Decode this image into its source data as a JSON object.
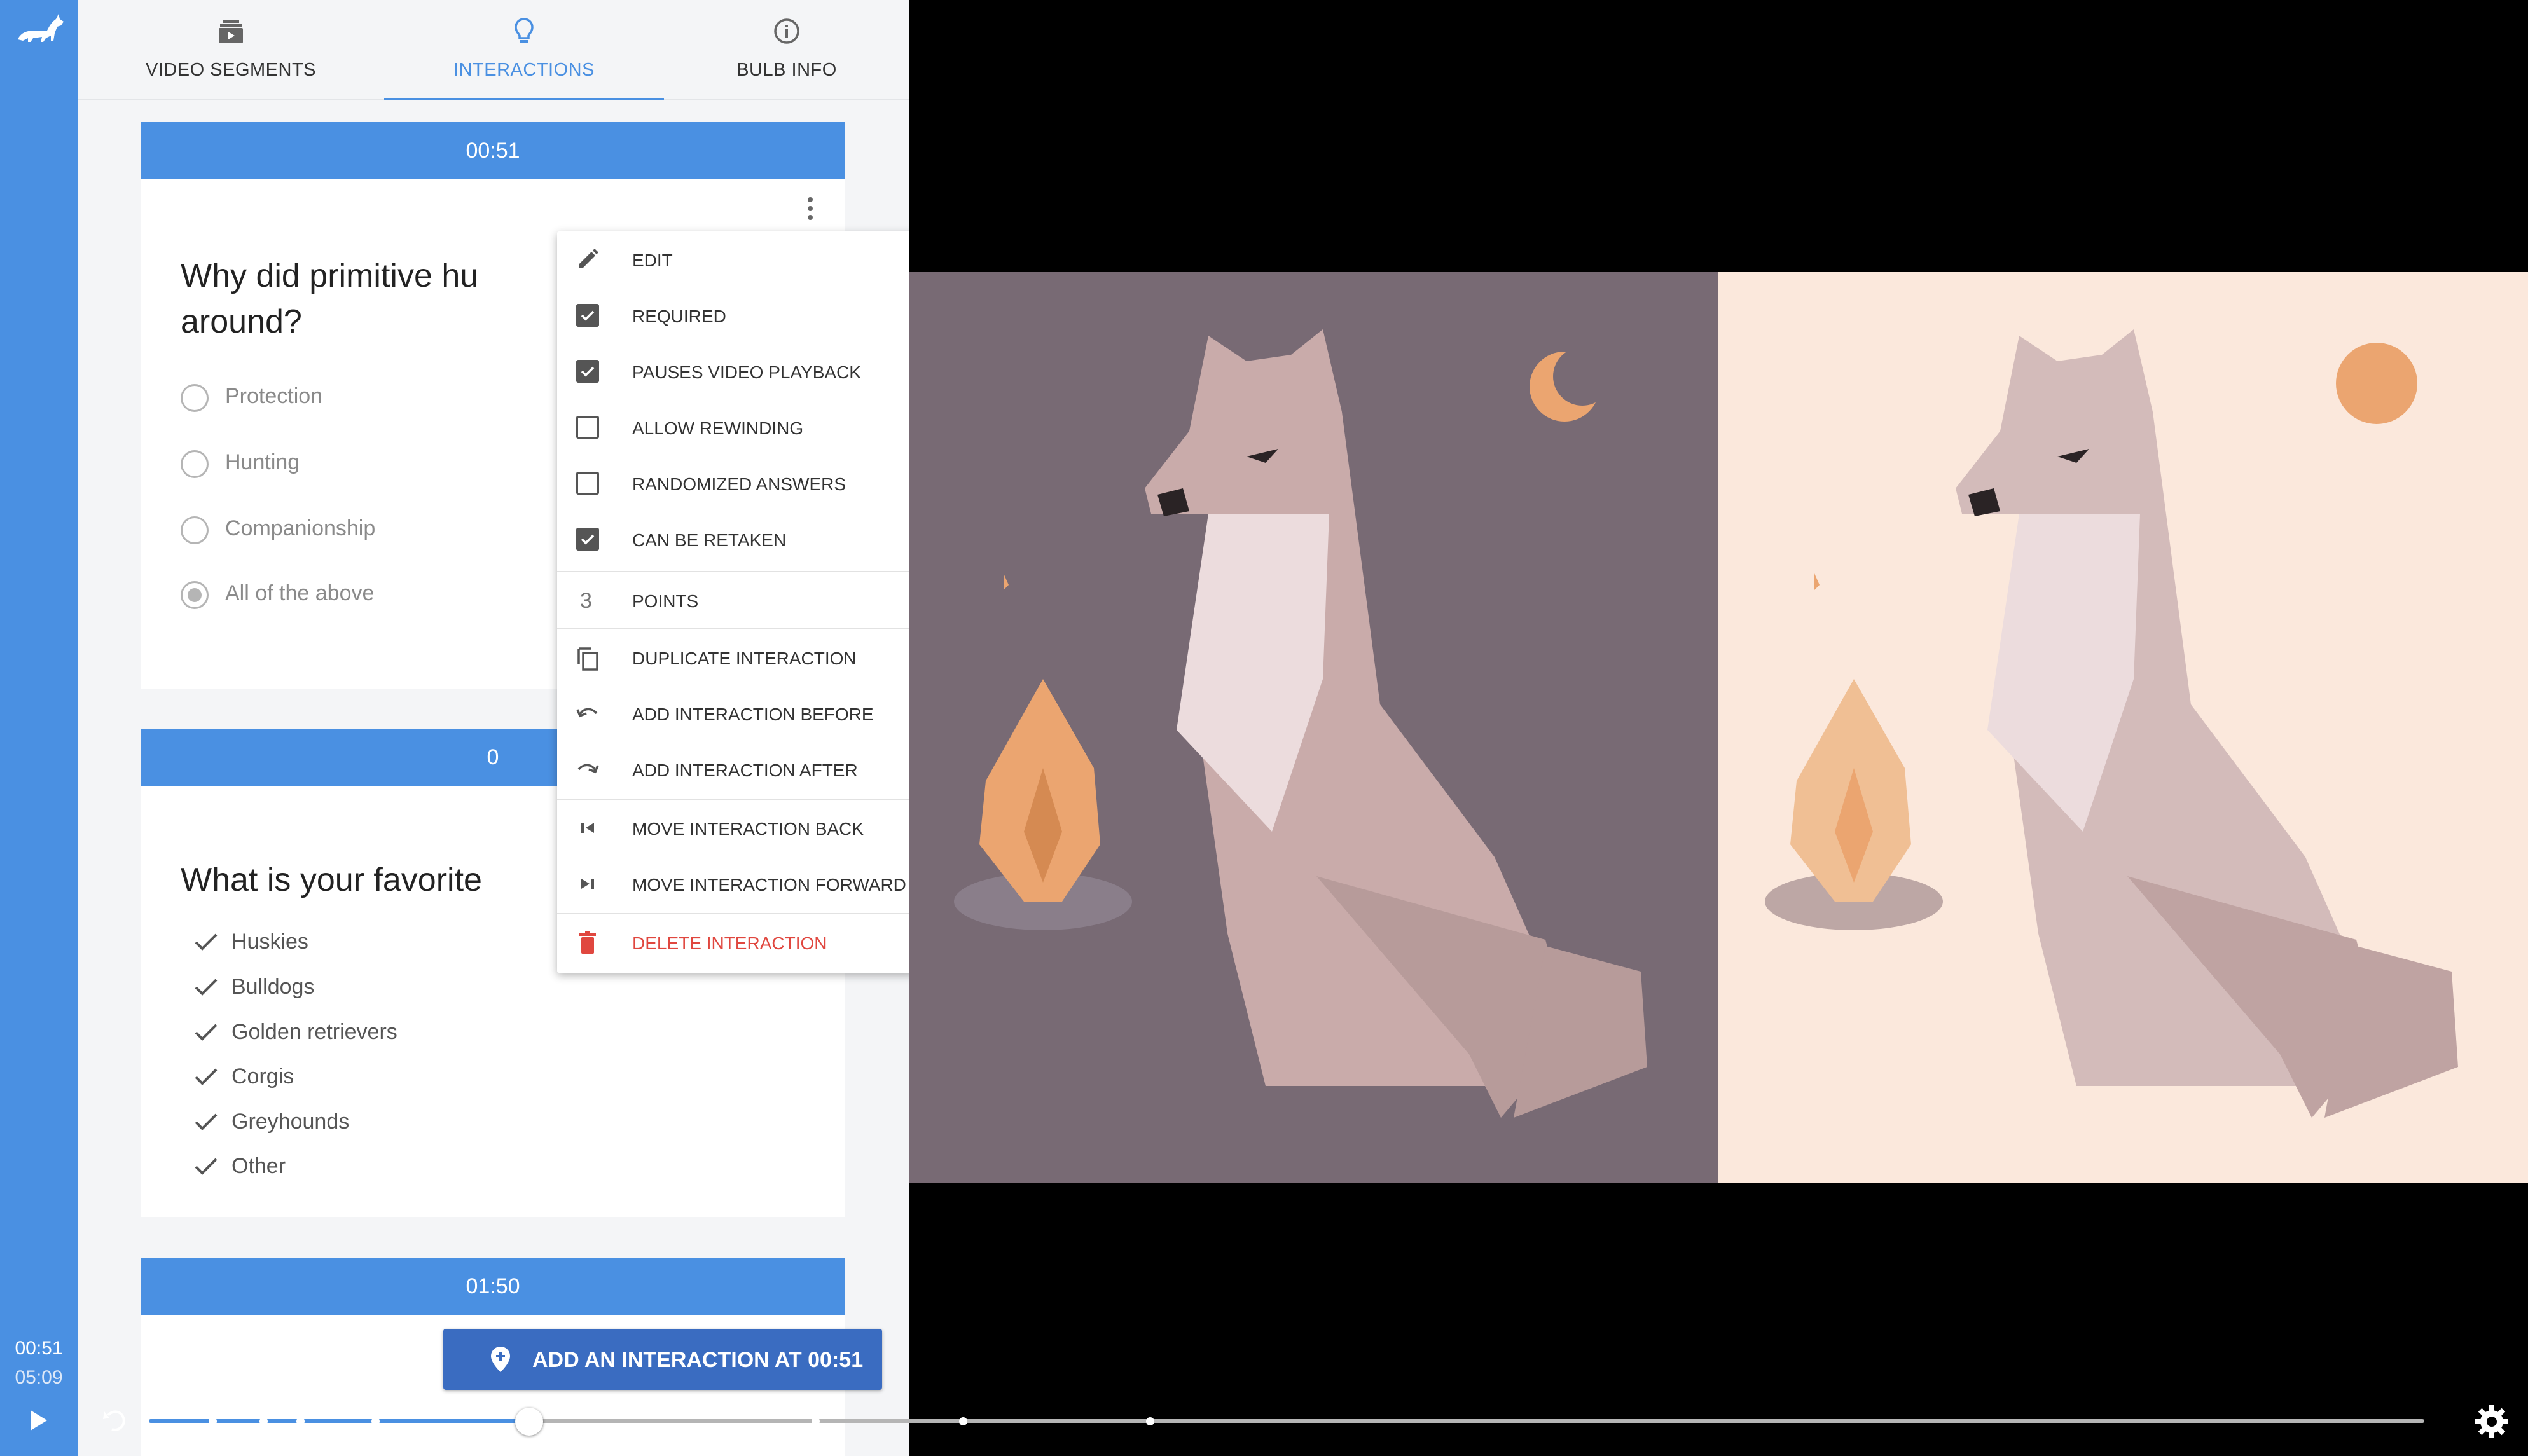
{
  "player": {
    "current_time": "00:51",
    "total_time": "05:09",
    "progress_fraction": 0.165
  },
  "tabs": [
    {
      "label": "VIDEO SEGMENTS",
      "icon": "video-segments-icon"
    },
    {
      "label": "INTERACTIONS",
      "icon": "lightbulb-icon",
      "active": true
    },
    {
      "label": "BULB INFO",
      "icon": "info-icon"
    }
  ],
  "interactions": [
    {
      "time": "00:51",
      "question": "Why did primitive hu",
      "question_line2": "around?",
      "options": [
        "Protection",
        "Hunting",
        "Companionship",
        "All of the above"
      ],
      "selected": "All of the above"
    },
    {
      "time": "0",
      "question": "What is your favorite",
      "choices": [
        "Huskies",
        "Bulldogs",
        "Golden retrievers",
        "Corgis",
        "Greyhounds",
        "Other"
      ]
    },
    {
      "time": "01:50"
    }
  ],
  "add_button": {
    "label": "ADD AN INTERACTION AT 00:51",
    "icon": "map-pin-plus-icon"
  },
  "context_menu": {
    "edit": {
      "label": "EDIT",
      "icon": "pencil-icon"
    },
    "required": {
      "label": "REQUIRED",
      "checked": true
    },
    "pauses": {
      "label": "PAUSES VIDEO PLAYBACK",
      "checked": true
    },
    "rewinding": {
      "label": "ALLOW REWINDING",
      "checked": false
    },
    "randomized": {
      "label": "RANDOMIZED ANSWERS",
      "checked": false
    },
    "retaken": {
      "label": "CAN BE RETAKEN",
      "checked": true
    },
    "points": {
      "value": "3",
      "label": "POINTS"
    },
    "duplicate": {
      "label": "DUPLICATE INTERACTION",
      "icon": "copy-icon"
    },
    "add_before": {
      "label": "ADD INTERACTION BEFORE",
      "icon": "undo-icon"
    },
    "add_after": {
      "label": "ADD INTERACTION AFTER",
      "icon": "redo-icon"
    },
    "move_back": {
      "label": "MOVE INTERACTION BACK",
      "icon": "skip-back-icon"
    },
    "move_forward": {
      "label": "MOVE INTERACTION FORWARD",
      "icon": "skip-forward-icon"
    },
    "delete": {
      "label": "DELETE INTERACTION",
      "icon": "trash-icon"
    }
  },
  "colors": {
    "accent": "#4a90e2",
    "add_button": "#3a6cc1",
    "danger": "#e0473f",
    "video_left_bg": "#786a74",
    "video_right_bg": "#fbe8dc",
    "wolf": "#c9abaa",
    "fire": "#eba570"
  }
}
